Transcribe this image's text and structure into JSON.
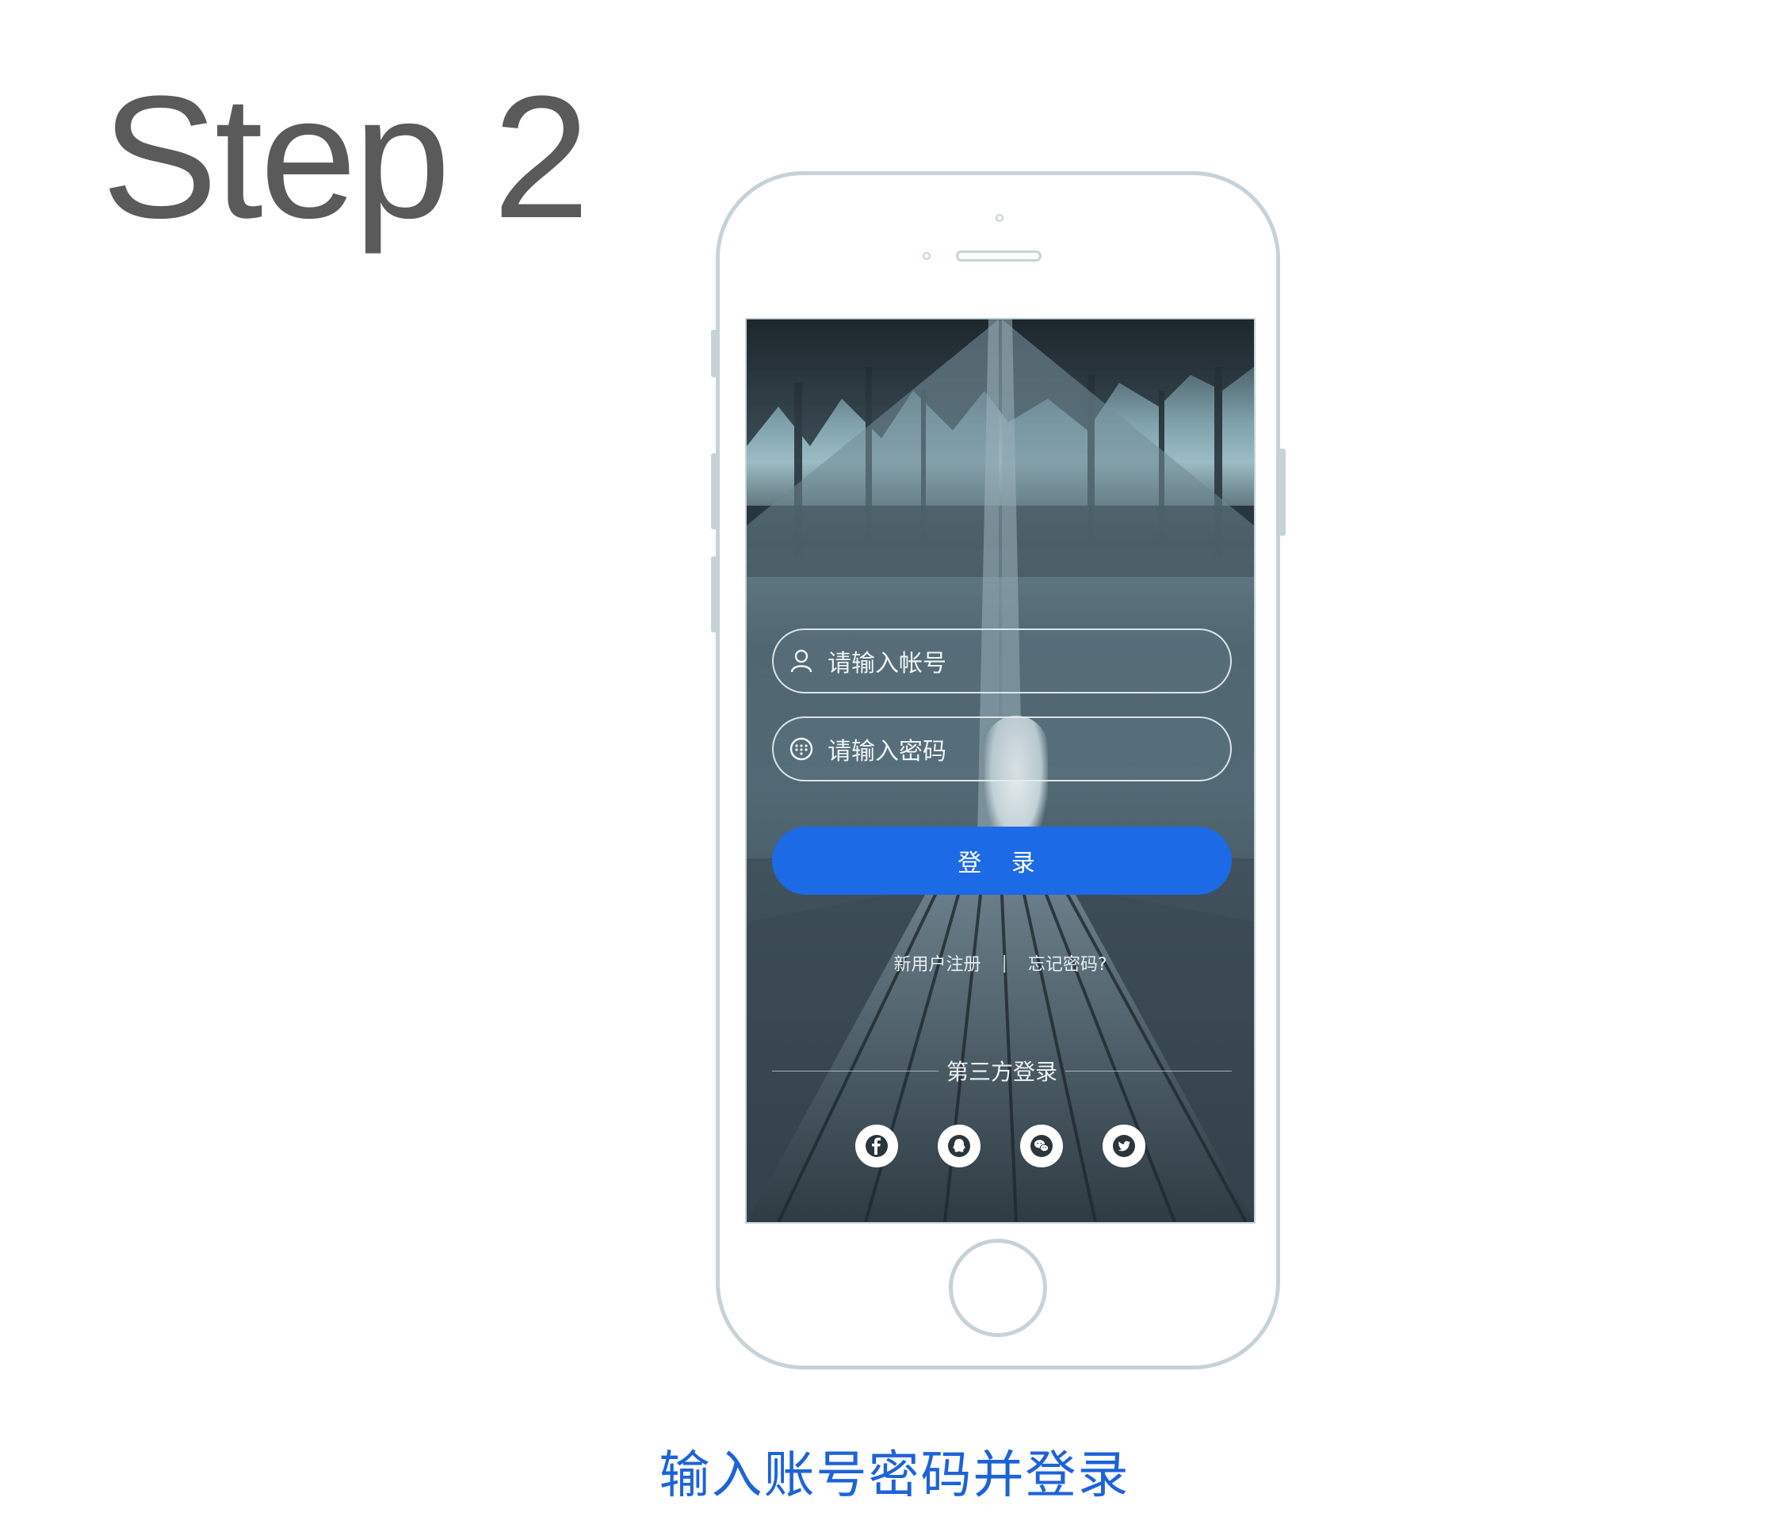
{
  "header": {
    "title": "Step 2"
  },
  "login": {
    "account_placeholder": "请输入帐号",
    "password_placeholder": "请输入密码",
    "login_button": "登 录",
    "register_link": "新用户注册",
    "separator": "|",
    "forgot_link": "忘记密码?",
    "third_party_label": "第三方登录",
    "socials": [
      "facebook-icon",
      "qq-icon",
      "wechat-icon",
      "twitter-icon"
    ]
  },
  "caption": "输入账号密码并登录",
  "colors": {
    "accent": "#1d6ae6",
    "caption": "#1d63d8",
    "phone_outline": "#c5d3d8",
    "title": "#5a5a5a"
  }
}
